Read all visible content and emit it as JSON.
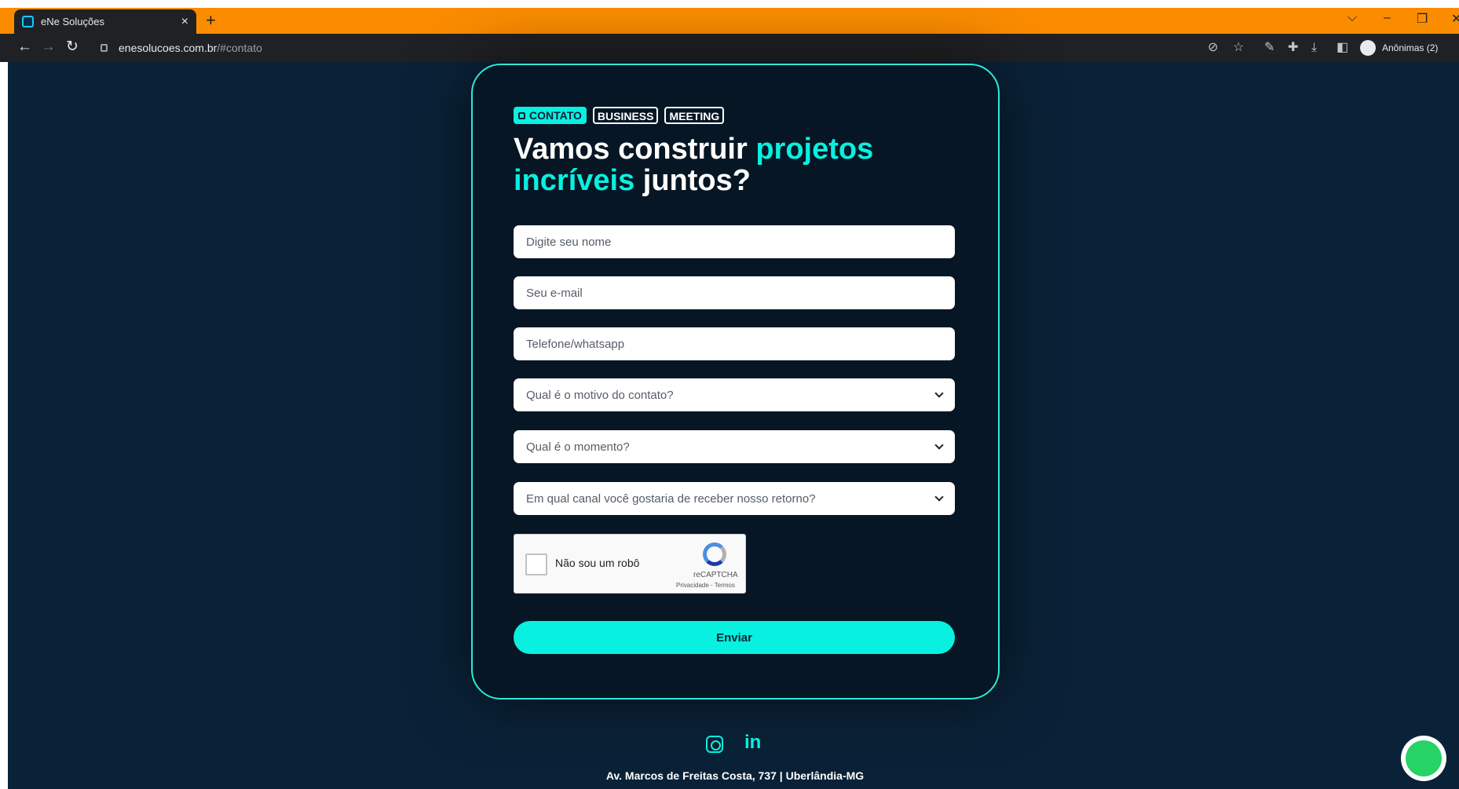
{
  "browser": {
    "tab_title": "eNe Soluções",
    "tab_close": "×",
    "new_tab": "+",
    "url_host": "enesolucoes.com.br",
    "url_path": "/#contato",
    "profile_label": "Anônimas (2)"
  },
  "contact": {
    "tags": [
      "CONTATO",
      "BUSINESS",
      "MEETING"
    ],
    "headline_part1": "Vamos construir ",
    "headline_highlight1": "projetos incríveis",
    "headline_part2": " juntos?",
    "name_placeholder": "Digite seu nome",
    "email_placeholder": "Seu e-mail",
    "phone_placeholder": "Telefone/whatsapp",
    "select_reason": "Qual é o motivo do contato?",
    "select_moment": "Qual é o momento?",
    "select_channel": "Em qual canal você gostaria de receber nosso retorno?",
    "captcha_label": "Não sou um robô",
    "captcha_brand": "reCAPTCHA",
    "captcha_links": "Privacidade - Termos",
    "submit_label": "Enviar"
  },
  "footer": {
    "linkedin_text": "in",
    "address": "Av. Marcos de Freitas Costa, 737 | Uberlândia-MG"
  },
  "colors": {
    "accent": "#08f0e0",
    "background": "#0a2237",
    "card": "#071624",
    "tabbar": "#fb8c00"
  }
}
